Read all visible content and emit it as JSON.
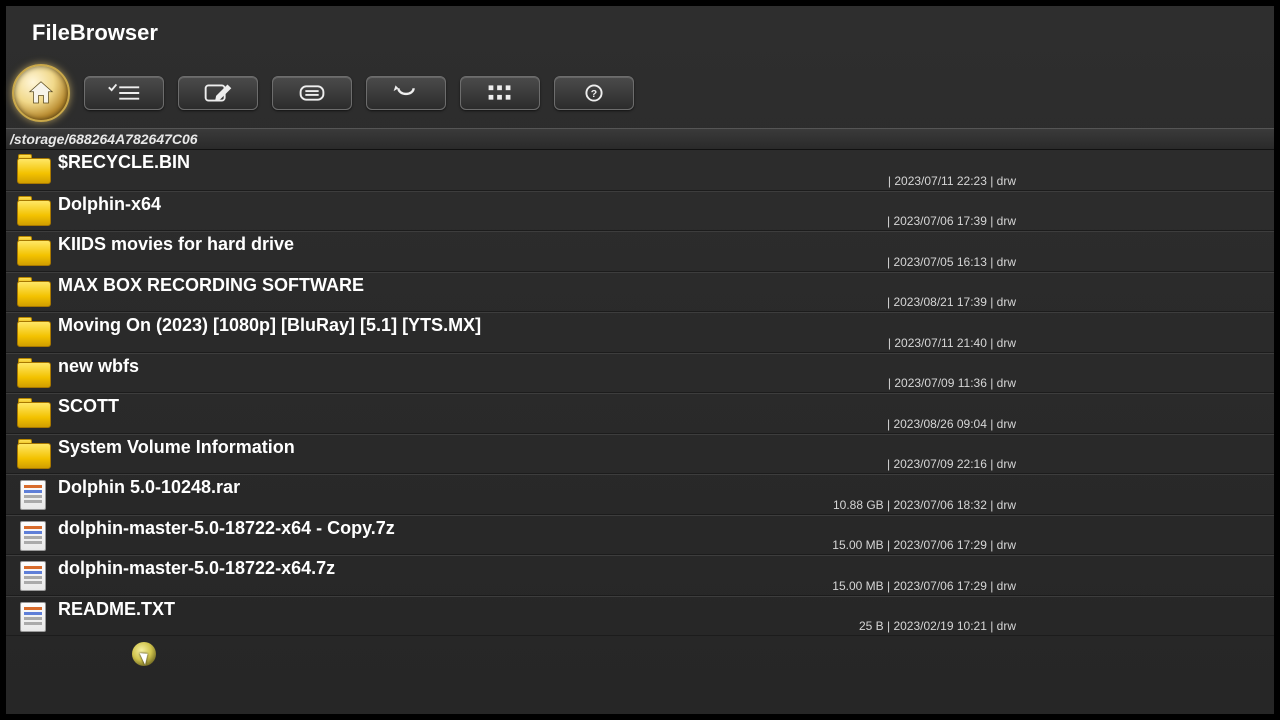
{
  "app_title": "FileBrowser",
  "current_path": "/storage/688264A782647C06",
  "toolbar": {
    "home": "home-icon",
    "select": "checklist-icon",
    "edit": "edit-icon",
    "details": "details-icon",
    "back": "back-icon",
    "grid": "grid-icon",
    "help": "help-icon"
  },
  "items": [
    {
      "type": "folder",
      "name": "$RECYCLE.BIN",
      "size": "",
      "date": "2023/07/11 22:23",
      "perm": "drw"
    },
    {
      "type": "folder",
      "name": "Dolphin-x64",
      "size": "",
      "date": "2023/07/06 17:39",
      "perm": "drw"
    },
    {
      "type": "folder",
      "name": "KIIDS movies for hard drive",
      "size": "",
      "date": "2023/07/05 16:13",
      "perm": "drw"
    },
    {
      "type": "folder",
      "name": "MAX BOX RECORDING SOFTWARE",
      "size": "",
      "date": "2023/08/21 17:39",
      "perm": "drw"
    },
    {
      "type": "folder",
      "name": "Moving On (2023) [1080p] [BluRay] [5.1] [YTS.MX]",
      "size": "",
      "date": "2023/07/11 21:40",
      "perm": "drw"
    },
    {
      "type": "folder",
      "name": "new wbfs",
      "size": "",
      "date": "2023/07/09 11:36",
      "perm": "drw"
    },
    {
      "type": "folder",
      "name": "SCOTT",
      "size": "",
      "date": "2023/08/26 09:04",
      "perm": "drw"
    },
    {
      "type": "folder",
      "name": "System Volume Information",
      "size": "",
      "date": "2023/07/09 22:16",
      "perm": "drw"
    },
    {
      "type": "file",
      "name": "Dolphin 5.0-10248.rar",
      "size": "10.88 GB",
      "date": "2023/07/06 18:32",
      "perm": "drw"
    },
    {
      "type": "file",
      "name": "dolphin-master-5.0-18722-x64 - Copy.7z",
      "size": "15.00 MB",
      "date": "2023/07/06 17:29",
      "perm": "drw"
    },
    {
      "type": "file",
      "name": "dolphin-master-5.0-18722-x64.7z",
      "size": "15.00 MB",
      "date": "2023/07/06 17:29",
      "perm": "drw"
    },
    {
      "type": "file",
      "name": "README.TXT",
      "size": "25 B",
      "date": "2023/02/19 10:21",
      "perm": "drw"
    }
  ]
}
